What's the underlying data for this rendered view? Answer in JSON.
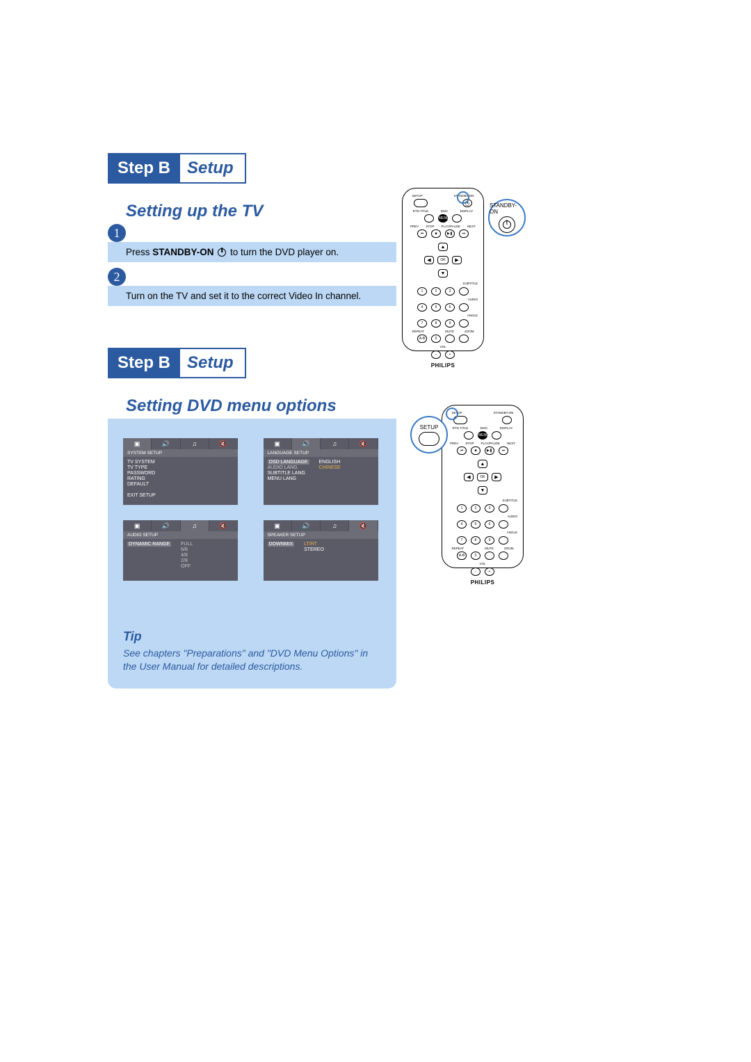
{
  "banner1": {
    "step": "Step B",
    "label": "Setup"
  },
  "banner2": {
    "step": "Step B",
    "label": "Setup"
  },
  "section1": {
    "title": "Setting up the TV",
    "num1": "1",
    "num2": "2",
    "instr1_pre": "Press ",
    "instr1_bold": "STANDBY-ON",
    "instr1_post": " to turn the DVD player on.",
    "instr2": "Turn on the TV and set it to the correct Video In channel."
  },
  "callout1": {
    "label": "STANDBY-ON"
  },
  "callout2": {
    "label": "SETUP"
  },
  "remote": {
    "setup": "SETUP",
    "standby": "STANDBY-ON",
    "rtn_title": "RTN TITLE",
    "disc": "DISC",
    "display": "DISPLAY",
    "menu": "MENU",
    "prev": "PREV",
    "stop": "STOP",
    "playpause": "PLAY/PAUSE",
    "next": "NEXT",
    "ok": "OK",
    "subtitle": "SUBTITLE",
    "audio": "AUDIO",
    "angle": "ANGLE",
    "zoom": "ZOOM",
    "repeat": "REPEAT",
    "mute": "MUTE",
    "ab": "A-B",
    "vol": "VOL",
    "brand": "PHILIPS",
    "n0": "0",
    "n1": "1",
    "n2": "2",
    "n3": "3",
    "n4": "4",
    "n5": "5",
    "n6": "6",
    "n7": "7",
    "n8": "8",
    "n9": "9",
    "minus": "−",
    "plus": "+"
  },
  "section2": {
    "title": "Setting DVD menu options"
  },
  "osd": {
    "system": {
      "header": "SYSTEM SETUP",
      "items": [
        "TV SYSTEM",
        "TV TYPE",
        "PASSWORD",
        "RATING",
        "DEFAULT"
      ],
      "exit": "EXIT SETUP"
    },
    "language": {
      "header": "LANGUAGE SETUP",
      "left": [
        "OSD LANGUAGE",
        "AUDIO LANG",
        "SUBTITLE LANG",
        "MENU LANG"
      ],
      "right": [
        "ENGLISH",
        "CHINESE"
      ]
    },
    "audio": {
      "header": "AUDIO SETUP",
      "left": "DYNAMIC RANGE",
      "opts": [
        "FULL",
        "6/8",
        "4/8",
        "2/8",
        "OFF"
      ]
    },
    "speaker": {
      "header": "SPEAKER SETUP",
      "left": "DOWNMIX",
      "opts": [
        "LT/RT",
        "STEREO"
      ]
    }
  },
  "tip": {
    "title": "Tip",
    "body": "See chapters \"Preparations\" and \"DVD Menu Options\" in the User Manual for detailed descriptions."
  }
}
